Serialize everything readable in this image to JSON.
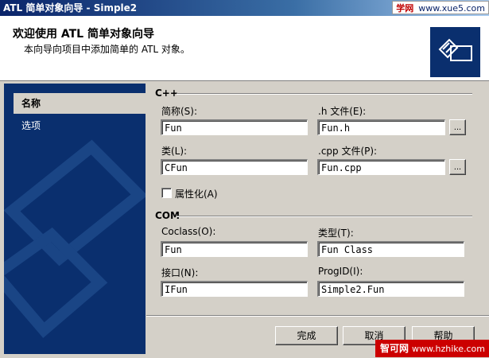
{
  "window": {
    "title": "ATL 简单对象向导 - Simple2"
  },
  "watermark_top": {
    "brand": "学网",
    "site": "www.xue5.com"
  },
  "header": {
    "title": "欢迎使用 ATL 简单对象向导",
    "subtitle": "本向导向项目中添加简单的 ATL 对象。",
    "logo": "atl-wizard-logo"
  },
  "nav": {
    "items": [
      {
        "label": "名称",
        "selected": true
      },
      {
        "label": "选项",
        "selected": false
      }
    ]
  },
  "cpp_section": {
    "label": "C++",
    "short_name": {
      "label": "简称(S):",
      "value": "Fun"
    },
    "h_file": {
      "label": ".h 文件(E):",
      "value": "Fun.h",
      "browse": "..."
    },
    "class": {
      "label": "类(L):",
      "value": "CFun"
    },
    "cpp_file": {
      "label": ".cpp 文件(P):",
      "value": "Fun.cpp",
      "browse": "..."
    },
    "attributed": {
      "label": "属性化(A)",
      "checked": false
    }
  },
  "com_section": {
    "label": "COM",
    "coclass": {
      "label": "Coclass(O):",
      "value": "Fun"
    },
    "type": {
      "label": "类型(T):",
      "value": "Fun Class"
    },
    "interface": {
      "label": "接口(N):",
      "value": "IFun"
    },
    "progid": {
      "label": "ProgID(I):",
      "value": "Simple2.Fun"
    }
  },
  "buttons": {
    "finish": "完成",
    "cancel": "取消",
    "help": "帮助"
  },
  "watermark_bottom": {
    "brand": "智可网",
    "site": "www.hzhike.com"
  },
  "colors": {
    "nav_bg": "#0a2f6e",
    "title_bar": "#0a246a",
    "dialog_bg": "#d4d0c8"
  }
}
